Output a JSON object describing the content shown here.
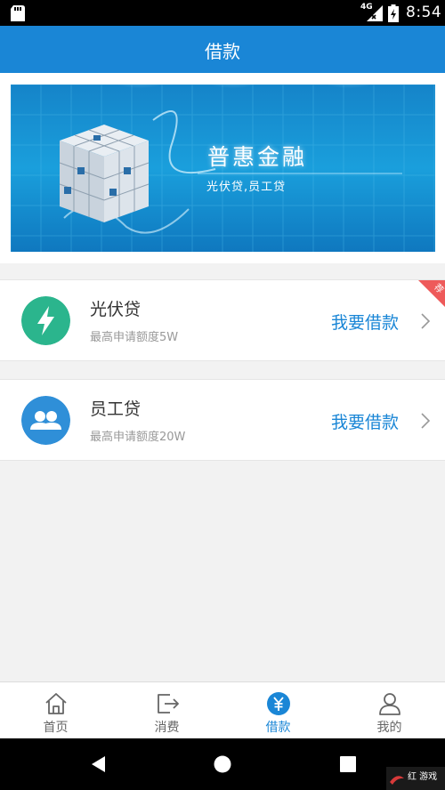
{
  "status_bar": {
    "network": "4G",
    "time": "8:54"
  },
  "header": {
    "title": "借款"
  },
  "banner": {
    "title": "普惠金融",
    "subtitle": "光伏贷,员工贷"
  },
  "loans": [
    {
      "name": "光伏贷",
      "desc": "最高申请额度5W",
      "action": "我要借款",
      "badge": "荐",
      "icon": "lightning-icon",
      "icon_color": "#2bb58d"
    },
    {
      "name": "员工贷",
      "desc": "最高申请额度20W",
      "action": "我要借款",
      "icon": "users-icon",
      "icon_color": "#2f8fd8"
    }
  ],
  "tabs": [
    {
      "label": "首页",
      "icon": "home-icon"
    },
    {
      "label": "消费",
      "icon": "exit-icon"
    },
    {
      "label": "借款",
      "icon": "yuan-icon",
      "active": true
    },
    {
      "label": "我的",
      "icon": "user-icon"
    }
  ],
  "colors": {
    "primary": "#1a86d6",
    "badge": "#ee5a5a",
    "background": "#f2f2f2"
  },
  "watermark": {
    "text": "红 游戏"
  }
}
